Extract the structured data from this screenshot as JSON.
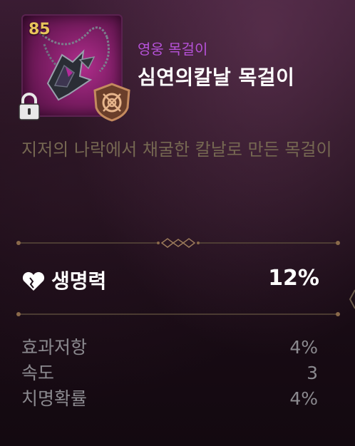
{
  "item": {
    "level": "85",
    "grade": "영웅 목걸이",
    "name": "심연의칼날 목걸이",
    "description": "지저의 나락에서 채굴한 칼날로 만든 목걸이",
    "icon": "necklace-icon",
    "locked": true
  },
  "main_stat": {
    "icon": "heart-icon",
    "name": "생명력",
    "value": "12%"
  },
  "sub_stats": [
    {
      "name": "효과저항",
      "value": "4%"
    },
    {
      "name": "속도",
      "value": "3"
    },
    {
      "name": "치명확률",
      "value": "4%"
    }
  ],
  "colors": {
    "grade": "#b652d8",
    "level": "#e9c45c",
    "description": "#766852",
    "sub_stat": "#8b8a8f",
    "frame": "#9b2680"
  }
}
